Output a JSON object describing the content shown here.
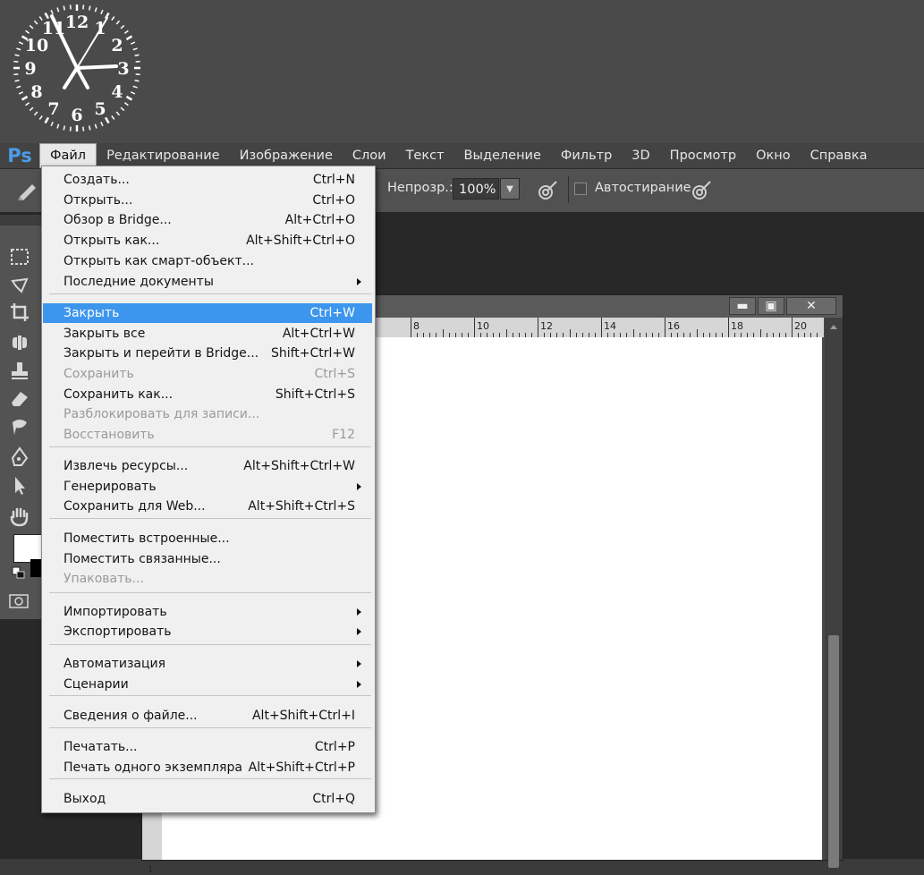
{
  "menubar": {
    "logo": "Ps",
    "items": [
      {
        "label": "Файл"
      },
      {
        "label": "Редактирование"
      },
      {
        "label": "Изображение"
      },
      {
        "label": "Слои"
      },
      {
        "label": "Текст"
      },
      {
        "label": "Выделение"
      },
      {
        "label": "Фильтр"
      },
      {
        "label": "3D"
      },
      {
        "label": "Просмотр"
      },
      {
        "label": "Окно"
      },
      {
        "label": "Справка"
      }
    ]
  },
  "options": {
    "opacity_label": "Непрозр.:",
    "opacity_value": "100%",
    "autoerase_label": "Автостирание",
    "autoerase_checked": false
  },
  "clock": {
    "numbers": [
      "12",
      "1",
      "2",
      "3",
      "4",
      "5",
      "6",
      "7",
      "8",
      "9",
      "10",
      "11"
    ]
  },
  "file_menu": {
    "items": [
      {
        "label": "Создать...",
        "shortcut": "Ctrl+N"
      },
      {
        "label": "Открыть...",
        "shortcut": "Ctrl+O"
      },
      {
        "label": "Обзор в Bridge...",
        "shortcut": "Alt+Ctrl+O"
      },
      {
        "label": "Открыть как...",
        "shortcut": "Alt+Shift+Ctrl+O"
      },
      {
        "label": "Открыть как смарт-объект...",
        "shortcut": ""
      },
      {
        "label": "Последние документы",
        "shortcut": "",
        "submenu": true
      },
      {
        "label": "Закрыть",
        "shortcut": "Ctrl+W",
        "highlighted": true
      },
      {
        "label": "Закрыть все",
        "shortcut": "Alt+Ctrl+W"
      },
      {
        "label": "Закрыть и перейти в Bridge...",
        "shortcut": "Shift+Ctrl+W"
      },
      {
        "label": "Сохранить",
        "shortcut": "Ctrl+S",
        "disabled": true
      },
      {
        "label": "Сохранить как...",
        "shortcut": "Shift+Ctrl+S"
      },
      {
        "label": "Разблокировать для записи...",
        "shortcut": "",
        "disabled": true
      },
      {
        "label": "Восстановить",
        "shortcut": "F12",
        "disabled": true
      },
      {
        "label": "Извлечь ресурсы...",
        "shortcut": "Alt+Shift+Ctrl+W"
      },
      {
        "label": "Генерировать",
        "shortcut": "",
        "submenu": true
      },
      {
        "label": "Сохранить для Web...",
        "shortcut": "Alt+Shift+Ctrl+S"
      },
      {
        "label": "Поместить встроенные...",
        "shortcut": ""
      },
      {
        "label": "Поместить связанные...",
        "shortcut": ""
      },
      {
        "label": "Упаковать...",
        "shortcut": "",
        "disabled": true
      },
      {
        "label": "Импортировать",
        "shortcut": "",
        "submenu": true
      },
      {
        "label": "Экспортировать",
        "shortcut": "",
        "submenu": true
      },
      {
        "label": "Автоматизация",
        "shortcut": "",
        "submenu": true
      },
      {
        "label": "Сценарии",
        "shortcut": "",
        "submenu": true
      },
      {
        "label": "Сведения о файле...",
        "shortcut": "Alt+Shift+Ctrl+I"
      },
      {
        "label": "Печатать...",
        "shortcut": "Ctrl+P"
      },
      {
        "label": "Печать одного экземпляра",
        "shortcut": "Alt+Shift+Ctrl+P"
      },
      {
        "label": "Выход",
        "shortcut": "Ctrl+Q"
      }
    ]
  },
  "document": {
    "ruler_labels": [
      "8",
      "10",
      "12",
      "14",
      "16",
      "18",
      "20"
    ],
    "vruler_label": "1"
  }
}
